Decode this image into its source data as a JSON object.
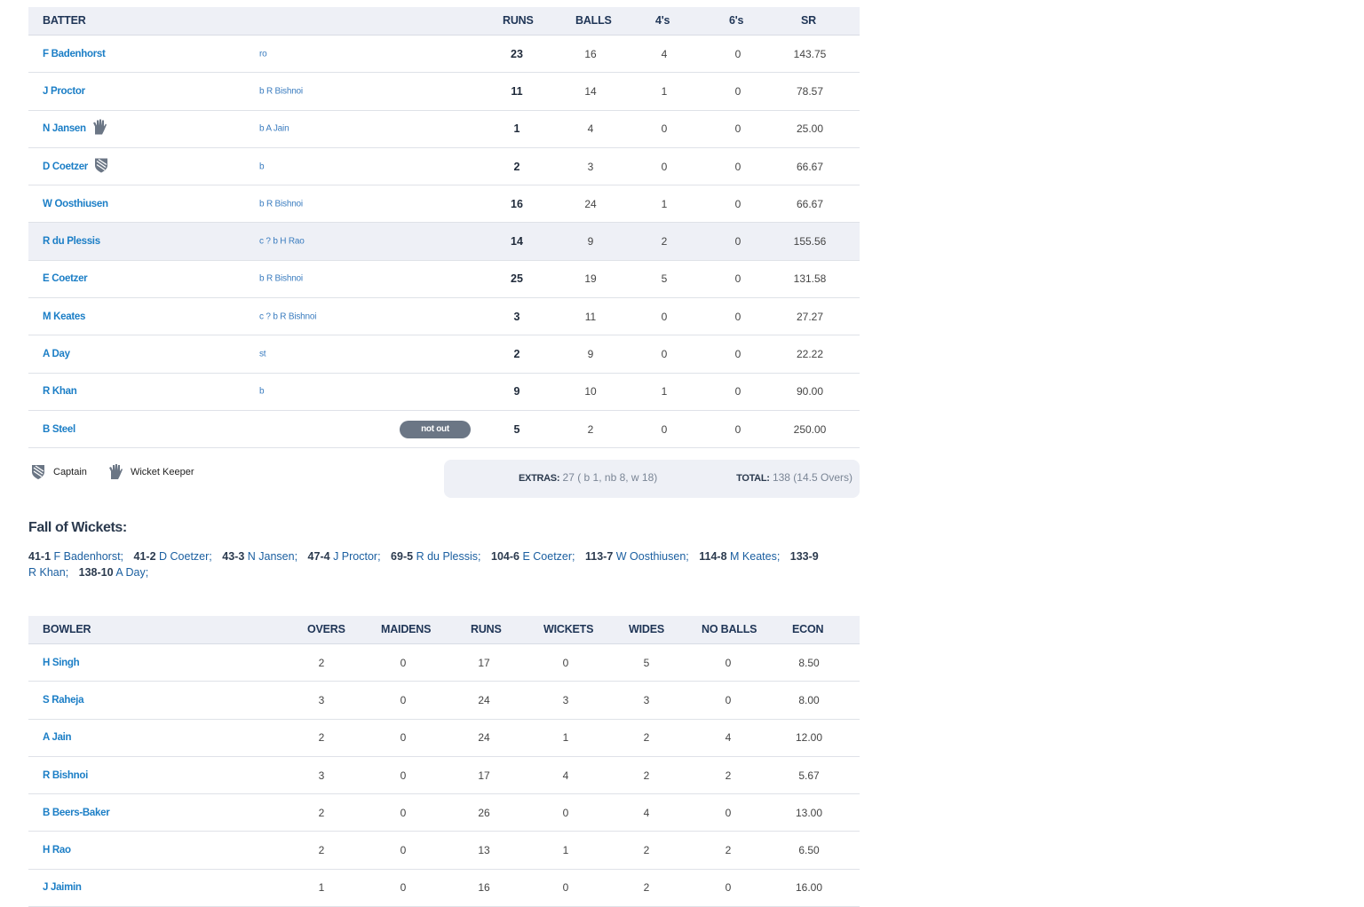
{
  "batting": {
    "headers": {
      "batter": "BATTER",
      "runs": "RUNS",
      "balls": "BALLS",
      "fours": "4's",
      "sixes": "6's",
      "sr": "SR"
    },
    "rows": [
      {
        "name": "F Badenhorst",
        "dismissal": "ro",
        "runs": "23",
        "balls": "16",
        "fours": "4",
        "sixes": "0",
        "sr": "143.75"
      },
      {
        "name": "J Proctor",
        "dismissal": "b R Bishnoi",
        "runs": "11",
        "balls": "14",
        "fours": "1",
        "sixes": "0",
        "sr": "78.57"
      },
      {
        "name": "N Jansen",
        "dismissal": "b A Jain",
        "runs": "1",
        "balls": "4",
        "fours": "0",
        "sixes": "0",
        "sr": "25.00",
        "icon": "wicket-keeper-glove-icon"
      },
      {
        "name": "D Coetzer",
        "dismissal": "b",
        "runs": "2",
        "balls": "3",
        "fours": "0",
        "sixes": "0",
        "sr": "66.67",
        "icon": "captain-shield-icon"
      },
      {
        "name": "W Oosthiusen",
        "dismissal": "b R Bishnoi",
        "runs": "16",
        "balls": "24",
        "fours": "1",
        "sixes": "0",
        "sr": "66.67"
      },
      {
        "name": "R du Plessis",
        "dismissal": "c ? b H Rao",
        "runs": "14",
        "balls": "9",
        "fours": "2",
        "sixes": "0",
        "sr": "155.56"
      },
      {
        "name": "E Coetzer",
        "dismissal": "b R Bishnoi",
        "runs": "25",
        "balls": "19",
        "fours": "5",
        "sixes": "0",
        "sr": "131.58"
      },
      {
        "name": "M Keates",
        "dismissal": "c ? b R Bishnoi",
        "runs": "3",
        "balls": "11",
        "fours": "0",
        "sixes": "0",
        "sr": "27.27"
      },
      {
        "name": "A Day",
        "dismissal": "st",
        "runs": "2",
        "balls": "9",
        "fours": "0",
        "sixes": "0",
        "sr": "22.22"
      },
      {
        "name": "R Khan",
        "dismissal": "b",
        "runs": "9",
        "balls": "10",
        "fours": "1",
        "sixes": "0",
        "sr": "90.00"
      },
      {
        "name": "B Steel",
        "dismissal": "",
        "status": "not out",
        "runs": "5",
        "balls": "2",
        "fours": "0",
        "sixes": "0",
        "sr": "250.00"
      }
    ]
  },
  "legend": {
    "captain": "Captain",
    "wicket_keeper": "Wicket Keeper"
  },
  "extras": {
    "label": "EXTRAS:",
    "value": "27 ( b 1, nb 8, w 18)"
  },
  "total": {
    "label": "TOTAL:",
    "value": "138 (14.5 Overs)"
  },
  "fall_of_wickets": {
    "title": "Fall of Wickets:",
    "items": [
      {
        "score": "41-1",
        "name": "F Badenhorst;"
      },
      {
        "score": "41-2",
        "name": "D Coetzer;"
      },
      {
        "score": "43-3",
        "name": "N Jansen;"
      },
      {
        "score": "47-4",
        "name": "J Proctor;"
      },
      {
        "score": "69-5",
        "name": "R du Plessis;"
      },
      {
        "score": "104-6",
        "name": "E Coetzer;"
      },
      {
        "score": "113-7",
        "name": "W Oosthiusen;"
      },
      {
        "score": "114-8",
        "name": "M Keates;"
      },
      {
        "score": "133-9",
        "name": "R Khan;"
      },
      {
        "score": "138-10",
        "name": "A Day;"
      }
    ]
  },
  "bowling": {
    "headers": {
      "bowler": "BOWLER",
      "overs": "OVERS",
      "maidens": "MAIDENS",
      "runs": "RUNS",
      "wickets": "WICKETS",
      "wides": "WIDES",
      "no_balls": "NO BALLS",
      "econ": "ECON"
    },
    "rows": [
      {
        "name": "H Singh",
        "overs": "2",
        "maidens": "0",
        "runs": "17",
        "wickets": "0",
        "wides": "5",
        "no_balls": "0",
        "econ": "8.50"
      },
      {
        "name": "S Raheja",
        "overs": "3",
        "maidens": "0",
        "runs": "24",
        "wickets": "3",
        "wides": "3",
        "no_balls": "0",
        "econ": "8.00"
      },
      {
        "name": "A Jain",
        "overs": "2",
        "maidens": "0",
        "runs": "24",
        "wickets": "1",
        "wides": "2",
        "no_balls": "4",
        "econ": "12.00"
      },
      {
        "name": "R Bishnoi",
        "overs": "3",
        "maidens": "0",
        "runs": "17",
        "wickets": "4",
        "wides": "2",
        "no_balls": "2",
        "econ": "5.67"
      },
      {
        "name": "B Beers-Baker",
        "overs": "2",
        "maidens": "0",
        "runs": "26",
        "wickets": "0",
        "wides": "4",
        "no_balls": "0",
        "econ": "13.00"
      },
      {
        "name": "H Rao",
        "overs": "2",
        "maidens": "0",
        "runs": "13",
        "wickets": "1",
        "wides": "2",
        "no_balls": "2",
        "econ": "6.50"
      },
      {
        "name": "J Jaimin",
        "overs": "1",
        "maidens": "0",
        "runs": "16",
        "wickets": "0",
        "wides": "2",
        "no_balls": "0",
        "econ": "16.00"
      }
    ]
  }
}
